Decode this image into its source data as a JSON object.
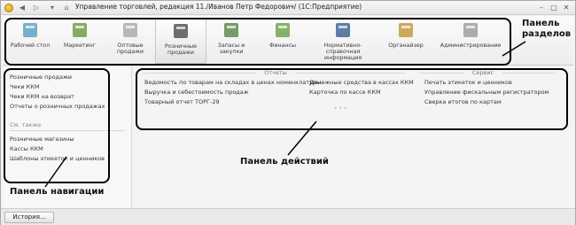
{
  "window": {
    "title": "Управление торговлей, редакция 11./Иванов Петр Федорович/ (1С:Предприятие)"
  },
  "sections": {
    "items": [
      {
        "label": "Рабочий стол",
        "icon": "desk-icon"
      },
      {
        "label": "Маркетинг",
        "icon": "marketing-icon"
      },
      {
        "label": "Оптовые продажи",
        "icon": "truck-icon"
      },
      {
        "label": "Розничные продажи",
        "icon": "cash-register-icon"
      },
      {
        "label": "Запасы и закупки",
        "icon": "warehouse-icon"
      },
      {
        "label": "Финансы",
        "icon": "coins-icon"
      },
      {
        "label": "Нормативно-справочная информация",
        "icon": "binders-icon"
      },
      {
        "label": "Органайзер",
        "icon": "organizer-icon"
      },
      {
        "label": "Администрирование",
        "icon": "admin-icon"
      }
    ],
    "active_index": 3
  },
  "navigation": {
    "items": [
      "Розничные продажи",
      "Чеки ККМ",
      "Чеки ККМ на возврат",
      "Отчеты о розничных продажах"
    ],
    "see_also_label": "См. также",
    "see_also_items": [
      "Розничные магазины",
      "Кассы ККМ",
      "Шаблоны этикеток и ценников"
    ]
  },
  "actions": {
    "reports": {
      "title": "Отчеты",
      "col1": [
        "Ведомость по товарам на складах в ценах номенклатуры",
        "Выручка и себестоимость продаж",
        "Товарный отчет ТОРГ-29"
      ],
      "col2": [
        "Денежные средства в кассах ККМ",
        "Карточка по кассе ККМ"
      ]
    },
    "service": {
      "title": "Сервис",
      "items": [
        "Печать этикеток и ценников",
        "Управление фискальным регистратором",
        "Сверка итогов по картам"
      ]
    }
  },
  "callouts": {
    "sections_panel": "Панель разделов",
    "actions_panel": "Панель действий",
    "navigation_panel": "Панель навигации"
  },
  "footer": {
    "history_label": "История..."
  }
}
